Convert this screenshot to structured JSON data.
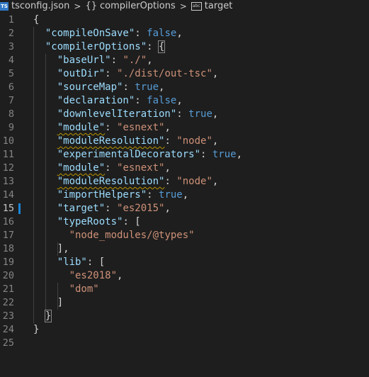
{
  "breadcrumb": {
    "file_icon": "TS",
    "file": "tsconfig.json",
    "braces": "{}",
    "section": "compilerOptions",
    "symbol_icon": "abc",
    "symbol": "target",
    "separator": ">"
  },
  "editor": {
    "active_line": 15,
    "lines": [
      {
        "n": "1",
        "tokens": [
          {
            "t": "{",
            "c": "p"
          }
        ]
      },
      {
        "n": "2",
        "tokens": [
          {
            "t": "  ",
            "c": "p"
          },
          {
            "t": "\"compileOnSave\"",
            "c": "k"
          },
          {
            "t": ": ",
            "c": "p"
          },
          {
            "t": "false",
            "c": "b"
          },
          {
            "t": ",",
            "c": "p"
          }
        ]
      },
      {
        "n": "3",
        "tokens": [
          {
            "t": "  ",
            "c": "p"
          },
          {
            "t": "\"compilerOptions\"",
            "c": "k"
          },
          {
            "t": ": ",
            "c": "p"
          },
          {
            "t": "{",
            "c": "p",
            "box": true
          }
        ]
      },
      {
        "n": "4",
        "tokens": [
          {
            "t": "    ",
            "c": "p"
          },
          {
            "t": "\"baseUrl\"",
            "c": "k"
          },
          {
            "t": ": ",
            "c": "p"
          },
          {
            "t": "\"./\"",
            "c": "s"
          },
          {
            "t": ",",
            "c": "p"
          }
        ]
      },
      {
        "n": "5",
        "tokens": [
          {
            "t": "    ",
            "c": "p"
          },
          {
            "t": "\"outDir\"",
            "c": "k"
          },
          {
            "t": ": ",
            "c": "p"
          },
          {
            "t": "\"./dist/out-tsc\"",
            "c": "s"
          },
          {
            "t": ",",
            "c": "p"
          }
        ]
      },
      {
        "n": "6",
        "tokens": [
          {
            "t": "    ",
            "c": "p"
          },
          {
            "t": "\"sourceMap\"",
            "c": "k"
          },
          {
            "t": ": ",
            "c": "p"
          },
          {
            "t": "true",
            "c": "b"
          },
          {
            "t": ",",
            "c": "p"
          }
        ]
      },
      {
        "n": "7",
        "tokens": [
          {
            "t": "    ",
            "c": "p"
          },
          {
            "t": "\"declaration\"",
            "c": "k"
          },
          {
            "t": ": ",
            "c": "p"
          },
          {
            "t": "false",
            "c": "b"
          },
          {
            "t": ",",
            "c": "p"
          }
        ]
      },
      {
        "n": "8",
        "tokens": [
          {
            "t": "    ",
            "c": "p"
          },
          {
            "t": "\"downlevelIteration\"",
            "c": "k"
          },
          {
            "t": ": ",
            "c": "p"
          },
          {
            "t": "true",
            "c": "b"
          },
          {
            "t": ",",
            "c": "p"
          }
        ]
      },
      {
        "n": "9",
        "tokens": [
          {
            "t": "    ",
            "c": "p"
          },
          {
            "t": "\"module\"",
            "c": "k",
            "squig": true
          },
          {
            "t": ": ",
            "c": "p"
          },
          {
            "t": "\"esnext\"",
            "c": "s"
          },
          {
            "t": ",",
            "c": "p"
          }
        ]
      },
      {
        "n": "10",
        "tokens": [
          {
            "t": "    ",
            "c": "p"
          },
          {
            "t": "\"moduleResolution\"",
            "c": "k",
            "squig": true
          },
          {
            "t": ": ",
            "c": "p"
          },
          {
            "t": "\"node\"",
            "c": "s"
          },
          {
            "t": ",",
            "c": "p"
          }
        ]
      },
      {
        "n": "11",
        "tokens": [
          {
            "t": "    ",
            "c": "p"
          },
          {
            "t": "\"experimentalDecorators\"",
            "c": "k"
          },
          {
            "t": ": ",
            "c": "p"
          },
          {
            "t": "true",
            "c": "b"
          },
          {
            "t": ",",
            "c": "p"
          }
        ]
      },
      {
        "n": "12",
        "tokens": [
          {
            "t": "    ",
            "c": "p"
          },
          {
            "t": "\"module\"",
            "c": "k",
            "squig": true
          },
          {
            "t": ": ",
            "c": "p"
          },
          {
            "t": "\"esnext\"",
            "c": "s"
          },
          {
            "t": ",",
            "c": "p"
          }
        ]
      },
      {
        "n": "13",
        "tokens": [
          {
            "t": "    ",
            "c": "p"
          },
          {
            "t": "\"moduleResolution\"",
            "c": "k",
            "squig": true
          },
          {
            "t": ": ",
            "c": "p"
          },
          {
            "t": "\"node\"",
            "c": "s"
          },
          {
            "t": ",",
            "c": "p"
          }
        ]
      },
      {
        "n": "14",
        "tokens": [
          {
            "t": "    ",
            "c": "p"
          },
          {
            "t": "\"importHelpers\"",
            "c": "k"
          },
          {
            "t": ": ",
            "c": "p"
          },
          {
            "t": "true",
            "c": "b"
          },
          {
            "t": ",",
            "c": "p"
          }
        ]
      },
      {
        "n": "15",
        "tokens": [
          {
            "t": "    ",
            "c": "p"
          },
          {
            "t": "\"target\"",
            "c": "k"
          },
          {
            "t": ": ",
            "c": "p"
          },
          {
            "t": "\"es2015\"",
            "c": "s"
          },
          {
            "t": ",",
            "c": "p"
          }
        ]
      },
      {
        "n": "16",
        "tokens": [
          {
            "t": "    ",
            "c": "p"
          },
          {
            "t": "\"typeRoots\"",
            "c": "k"
          },
          {
            "t": ": [",
            "c": "p"
          }
        ]
      },
      {
        "n": "17",
        "tokens": [
          {
            "t": "      ",
            "c": "p"
          },
          {
            "t": "\"node_modules/@types\"",
            "c": "s"
          }
        ]
      },
      {
        "n": "18",
        "tokens": [
          {
            "t": "    ",
            "c": "p"
          },
          {
            "t": "],",
            "c": "p"
          }
        ]
      },
      {
        "n": "19",
        "tokens": [
          {
            "t": "    ",
            "c": "p"
          },
          {
            "t": "\"lib\"",
            "c": "k"
          },
          {
            "t": ": [",
            "c": "p"
          }
        ]
      },
      {
        "n": "20",
        "tokens": [
          {
            "t": "      ",
            "c": "p"
          },
          {
            "t": "\"es2018\"",
            "c": "s"
          },
          {
            "t": ",",
            "c": "p"
          }
        ]
      },
      {
        "n": "21",
        "tokens": [
          {
            "t": "      ",
            "c": "p"
          },
          {
            "t": "\"dom\"",
            "c": "s"
          }
        ]
      },
      {
        "n": "22",
        "tokens": [
          {
            "t": "    ",
            "c": "p"
          },
          {
            "t": "]",
            "c": "p"
          }
        ]
      },
      {
        "n": "23",
        "tokens": [
          {
            "t": "  ",
            "c": "p"
          },
          {
            "t": "}",
            "c": "p",
            "box": true
          }
        ]
      },
      {
        "n": "24",
        "tokens": [
          {
            "t": "}",
            "c": "p"
          }
        ]
      },
      {
        "n": "25",
        "tokens": []
      }
    ]
  },
  "colors": {
    "background": "#1e1e1e",
    "key": "#9cdcfe",
    "string": "#ce9178",
    "boolean": "#569cd6",
    "punctuation": "#d4d4d4",
    "line_number": "#858585",
    "active_marker": "#1a85d6",
    "warning_squiggle": "#b89500"
  }
}
